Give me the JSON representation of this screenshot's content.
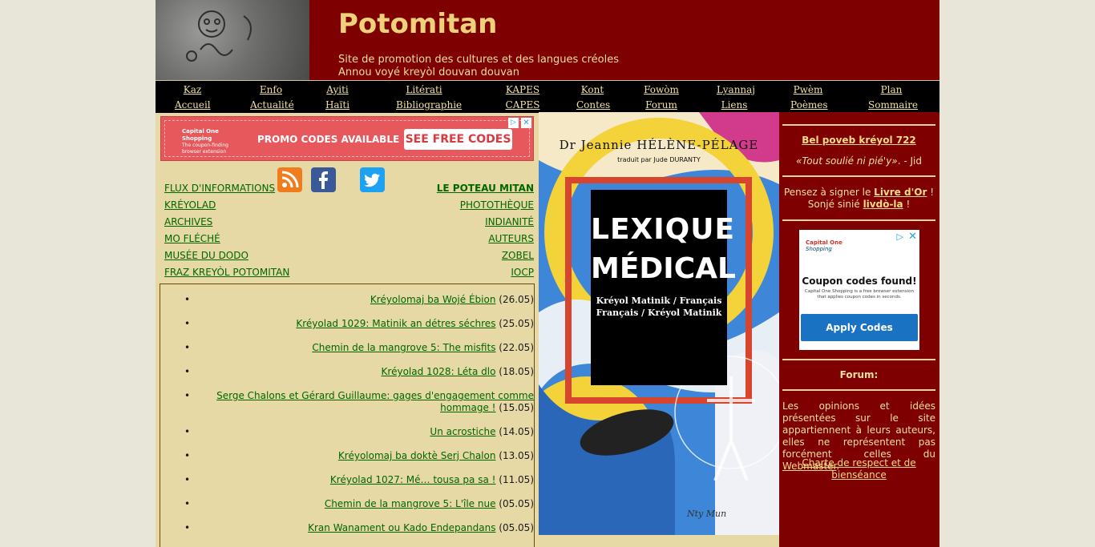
{
  "header": {
    "title": "Potomitan",
    "tagline_1": "Site de promotion des cultures et des langues créoles",
    "tagline_2": "Annou voyé kreyòl douvan douvan"
  },
  "nav": [
    {
      "top": "Kaz",
      "bottom": "Accueil"
    },
    {
      "top": "Enfo",
      "bottom": "Actualité"
    },
    {
      "top": "Ayiti",
      "bottom": "Haïti"
    },
    {
      "top": "Litérati",
      "bottom": "Bibliographie"
    },
    {
      "top": "KAPES",
      "bottom": "CAPES"
    },
    {
      "top": "Kont",
      "bottom": "Contes"
    },
    {
      "top": "Fowòm",
      "bottom": "Forum"
    },
    {
      "top": "Lyannaj",
      "bottom": "Liens"
    },
    {
      "top": "Pwèm",
      "bottom": "Poèmes"
    },
    {
      "top": "Plan",
      "bottom": "Sommaire"
    }
  ],
  "ad_left": {
    "brand": "Capital One Shopping",
    "brand_sub": "The coupon-finding browser extension",
    "promo": "PROMO CODES AVAILABLE",
    "cta": "SEE FREE CODES"
  },
  "social": {
    "rss": "rss-icon",
    "facebook": "facebook-icon",
    "twitter": "twitter-icon"
  },
  "links_left": [
    "FLUX D'INFORMATIONS",
    "KRÉYOLAD",
    "ARCHIVES",
    "MO FLÉCHÉ",
    "MUSÉE DU DODO",
    "FRAZ KREYÒL POTOMITAN"
  ],
  "links_right": [
    "LE POTEAU MITAN",
    "PHOTOTHÈQUE",
    "INDIANITÉ",
    "AUTEURS",
    "ZOBEL",
    "IOCP"
  ],
  "news": [
    {
      "title": "Kréyolomaj ba Wojé Ébion",
      "date": "(26.05)"
    },
    {
      "title": "Kréyolad 1029: Matinik an détres séchres",
      "date": "(25.05)"
    },
    {
      "title": "Chemin de la mangrove 5: The misfits",
      "date": "(22.05)"
    },
    {
      "title": "Kréyolad 1028: Léta dlo",
      "date": "(18.05)"
    },
    {
      "title": "Serge Chalons et Gérard Guillaume: gages d'engagement comme hommage !",
      "date": "(15.05)"
    },
    {
      "title": "Un acrostiche",
      "date": "(14.05)"
    },
    {
      "title": "Kréyolomaj ba doktè Serj Chalon",
      "date": "(13.05)"
    },
    {
      "title": "Kréyolad 1027: Mé… tousa pa sa !",
      "date": "(11.05)"
    },
    {
      "title": "Chemin de la mangrove 5: L'île nue",
      "date": "(05.05)"
    },
    {
      "title": "Kran Wanament ou Kado Endepandans",
      "date": "(05.05)"
    }
  ],
  "book": {
    "author": "Dr Jeannie HÉLÈNE-PÉLAGE",
    "translator": "traduit par Jude DURANTY",
    "title_1": "LEXIQUE",
    "title_2": "MÉDICAL",
    "subtitle_1": "Kréyol Matinik / Français",
    "subtitle_2": "Français / Kréyol Matinik"
  },
  "sidebar": {
    "proverb_title": "Bel poveb kréyol 722",
    "proverb_quote": "«Tout soulié ni pié'y»",
    "proverb_author": ". - Jid",
    "guestbook_pre": "Pensez à signer le ",
    "guestbook_link": "Livre d'Or",
    "guestbook_post": " !",
    "guestbook2_pre": "Sonjé sinié ",
    "guestbook2_link": "livdò-la",
    "guestbook2_post": " !",
    "forum": "Forum:",
    "disclaimer_text": "Les opinions et idées présentées sur le site appartiennent à leurs auteurs, elles ne représentent pas forcément celles du ",
    "disclaimer_link": "Webmaster",
    "disclaimer_end": ".",
    "charter": "Charte de respect et de bienséance"
  },
  "ad_right": {
    "brand": "Capital One",
    "brand_sub": "Shopping",
    "headline": "Coupon codes found!",
    "body": "Capital One Shopping is a free browser extension that applies coupon codes in seconds.",
    "cta": "Apply Codes"
  }
}
